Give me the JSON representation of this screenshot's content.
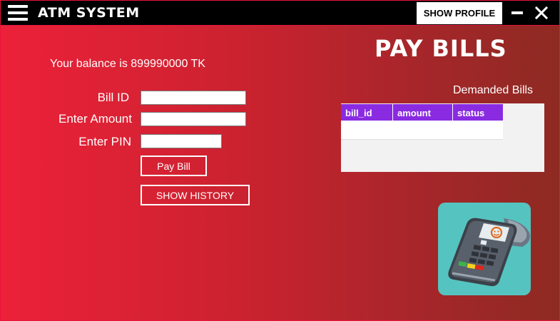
{
  "window": {
    "app_title": "ATM SYSTEM",
    "profile_button": "SHOW PROFILE",
    "menu_icon": "hamburger-menu-icon",
    "minimize_icon": "minimize-icon",
    "close_icon": "close-icon"
  },
  "page": {
    "heading": "PAY BILLS",
    "balance_text": "Your balance is 899990000 TK"
  },
  "form": {
    "bill_id_label": "Bill ID",
    "bill_id_value": "",
    "amount_label": "Enter Amount",
    "amount_value": "",
    "pin_label": "Enter PIN",
    "pin_value": "",
    "pay_button": "Pay Bill",
    "history_button": "SHOW HISTORY"
  },
  "bills": {
    "title": "Demanded Bills",
    "columns": [
      "bill_id",
      "amount",
      "status"
    ],
    "rows": []
  },
  "illustration": {
    "icon": "card-payment-terminal-icon"
  },
  "colors": {
    "accent": "#8a2be2",
    "background_start": "#ec2139",
    "background_end": "#8e2a22",
    "card": "#55c4c0"
  }
}
